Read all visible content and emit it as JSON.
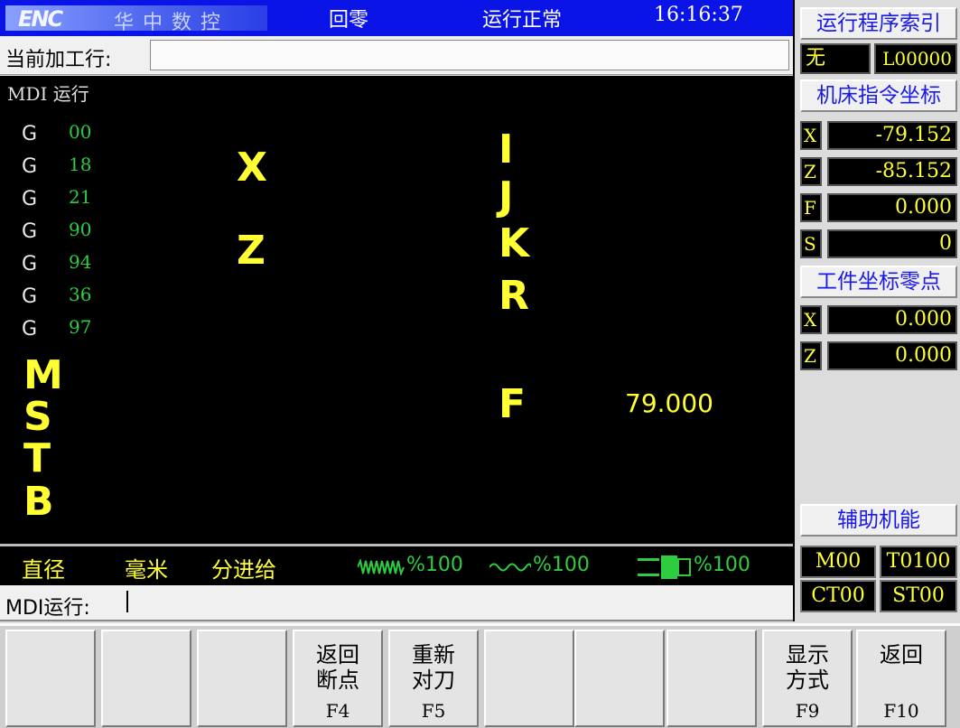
{
  "top": {
    "logo_mark": "ENC",
    "logo_text": "华中数控",
    "mode": "回零",
    "status": "运行正常",
    "time": "16:16:37"
  },
  "current_line": {
    "label": "当前加工行:"
  },
  "main": {
    "title": "MDI 运行",
    "g_codes": [
      {
        "letter": "G",
        "code": "00"
      },
      {
        "letter": "G",
        "code": "18"
      },
      {
        "letter": "G",
        "code": "21"
      },
      {
        "letter": "G",
        "code": "90"
      },
      {
        "letter": "G",
        "code": "94"
      },
      {
        "letter": "G",
        "code": "36"
      },
      {
        "letter": "G",
        "code": "97"
      }
    ],
    "mstb": [
      "M",
      "S",
      "T",
      "B"
    ],
    "axes_left": [
      "X",
      "Z"
    ],
    "axes_right": [
      "I",
      "J",
      "K",
      "R"
    ],
    "feed_letter": "F",
    "feed_value": "79.000"
  },
  "status": {
    "diameter": "直径",
    "unit": "毫米",
    "feed_mode": "分进给",
    "feed_override": "%100",
    "rapid_override": "%100",
    "spindle_override": "%100"
  },
  "mdi": {
    "label": "MDI运行:"
  },
  "fkeys": [
    {
      "label": "",
      "code": ""
    },
    {
      "label": "",
      "code": ""
    },
    {
      "label": "",
      "code": ""
    },
    {
      "label": "返回\n断点",
      "code": "F4"
    },
    {
      "label": "重新\n对刀",
      "code": "F5"
    },
    {
      "label": "",
      "code": ""
    },
    {
      "label": "",
      "code": ""
    },
    {
      "label": "",
      "code": ""
    },
    {
      "label": "显示\n方式",
      "code": "F9"
    },
    {
      "label": "返回",
      "code": "F10"
    }
  ],
  "right": {
    "program_index_title": "运行程序索引",
    "program_name": "无",
    "program_line": "L00000",
    "machine_coord_title": "机床指令坐标",
    "machine": [
      {
        "key": "X",
        "value": "-79.152"
      },
      {
        "key": "Z",
        "value": "-85.152"
      },
      {
        "key": "F",
        "value": "0.000"
      },
      {
        "key": "S",
        "value": "0"
      }
    ],
    "work_zero_title": "工件坐标零点",
    "work": [
      {
        "key": "X",
        "value": "0.000"
      },
      {
        "key": "Z",
        "value": "0.000"
      }
    ],
    "aux_title": "辅助机能",
    "aux": [
      "M00",
      "T0100",
      "CT00",
      "ST00"
    ]
  },
  "colors": {
    "title_bar": "#0a14e6",
    "value_yellow": "#ffff33",
    "gcode_green": "#2ecc40"
  }
}
